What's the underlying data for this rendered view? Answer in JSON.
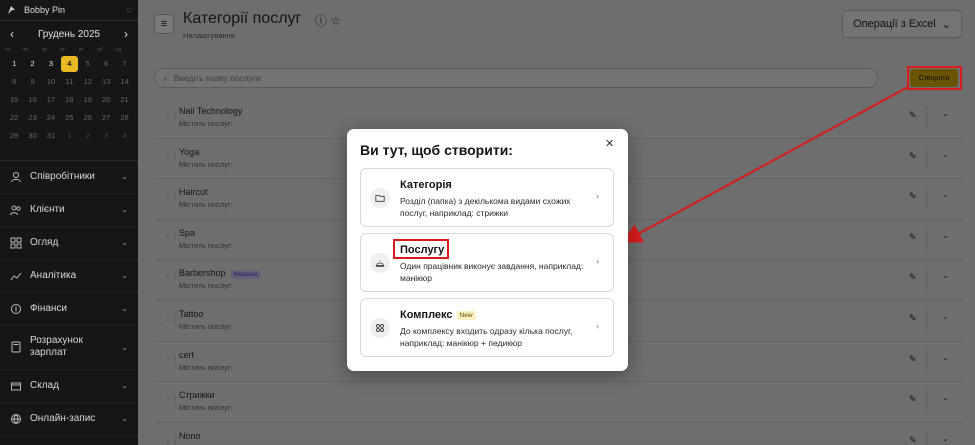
{
  "sidebar": {
    "user": "Bobby Pin",
    "calendar": {
      "month": "Грудень 2025",
      "weekdays": [
        "пн",
        "вт",
        "ср",
        "чт",
        "пт",
        "сб",
        "нд"
      ],
      "days": [
        {
          "d": "1",
          "s": "cur"
        },
        {
          "d": "2",
          "s": "cur"
        },
        {
          "d": "3",
          "s": "cur"
        },
        {
          "d": "4",
          "s": "today"
        },
        {
          "d": "5",
          "s": ""
        },
        {
          "d": "6",
          "s": ""
        },
        {
          "d": "7",
          "s": ""
        },
        {
          "d": "8",
          "s": ""
        },
        {
          "d": "9",
          "s": ""
        },
        {
          "d": "10",
          "s": ""
        },
        {
          "d": "11",
          "s": ""
        },
        {
          "d": "12",
          "s": ""
        },
        {
          "d": "13",
          "s": ""
        },
        {
          "d": "14",
          "s": ""
        },
        {
          "d": "15",
          "s": ""
        },
        {
          "d": "16",
          "s": ""
        },
        {
          "d": "17",
          "s": ""
        },
        {
          "d": "18",
          "s": ""
        },
        {
          "d": "19",
          "s": ""
        },
        {
          "d": "20",
          "s": ""
        },
        {
          "d": "21",
          "s": ""
        },
        {
          "d": "22",
          "s": ""
        },
        {
          "d": "23",
          "s": ""
        },
        {
          "d": "24",
          "s": ""
        },
        {
          "d": "25",
          "s": ""
        },
        {
          "d": "26",
          "s": ""
        },
        {
          "d": "27",
          "s": ""
        },
        {
          "d": "28",
          "s": ""
        },
        {
          "d": "29",
          "s": ""
        },
        {
          "d": "30",
          "s": ""
        },
        {
          "d": "31",
          "s": ""
        },
        {
          "d": "1",
          "s": "dim"
        },
        {
          "d": "2",
          "s": "dim"
        },
        {
          "d": "3",
          "s": "dim"
        },
        {
          "d": "4",
          "s": "dim"
        }
      ]
    },
    "menu": [
      {
        "label": "Співробітники",
        "icon": "user-icon",
        "tall": false
      },
      {
        "label": "Клієнти",
        "icon": "users-icon",
        "tall": false
      },
      {
        "label": "Огляд",
        "icon": "grid-icon",
        "tall": false
      },
      {
        "label": "Аналітика",
        "icon": "chart-icon",
        "tall": false
      },
      {
        "label": "Фінанси",
        "icon": "coin-icon",
        "tall": false
      },
      {
        "label": "Розрахунок зарплат",
        "icon": "calculator-icon",
        "tall": true
      },
      {
        "label": "Склад",
        "icon": "box-icon",
        "tall": false
      },
      {
        "label": "Онлайн-запис",
        "icon": "globe-icon",
        "tall": false
      }
    ]
  },
  "header": {
    "title": "Категорії послуг",
    "subtitle": "Налаштування",
    "excel_label": "Операції з Excel"
  },
  "search": {
    "placeholder": "Введіть назву послуги"
  },
  "create_label": "Створити",
  "services": [
    {
      "name": "Nail Technology",
      "sub": "Містить послуг:",
      "badge": ""
    },
    {
      "name": "Yoga",
      "sub": "Містить послуг:",
      "badge": ""
    },
    {
      "name": "Haircut",
      "sub": "Містить послуг:",
      "badge": ""
    },
    {
      "name": "Spa",
      "sub": "Містить послуг:",
      "badge": ""
    },
    {
      "name": "Barbershop",
      "sub": "Містить послуг:",
      "badge": "Мережа"
    },
    {
      "name": "Tattoo",
      "sub": "Містить послуг:",
      "badge": ""
    },
    {
      "name": "cert",
      "sub": "Містить послуг:",
      "badge": ""
    },
    {
      "name": "Стрижки",
      "sub": "Містить послуг:",
      "badge": ""
    },
    {
      "name": "Nono",
      "sub": "",
      "badge": ""
    }
  ],
  "modal": {
    "title": "Ви тут, щоб створити:",
    "options": [
      {
        "title": "Категорія",
        "desc": "Розділ (папка) з декількома видами схожих послуг, наприклад: стрижки",
        "badge": ""
      },
      {
        "title": "Послугу",
        "desc": "Один працівник виконує завдання, наприклад: манікюр",
        "badge": ""
      },
      {
        "title": "Комплекс",
        "desc": "До комплексу входить одразу кілька послуг, наприклад: манікюр + педикюр",
        "badge": "New"
      }
    ]
  },
  "colors": {
    "accent": "#e8b923",
    "highlight": "#d81c1c",
    "sidebar_bg": "#161616"
  }
}
